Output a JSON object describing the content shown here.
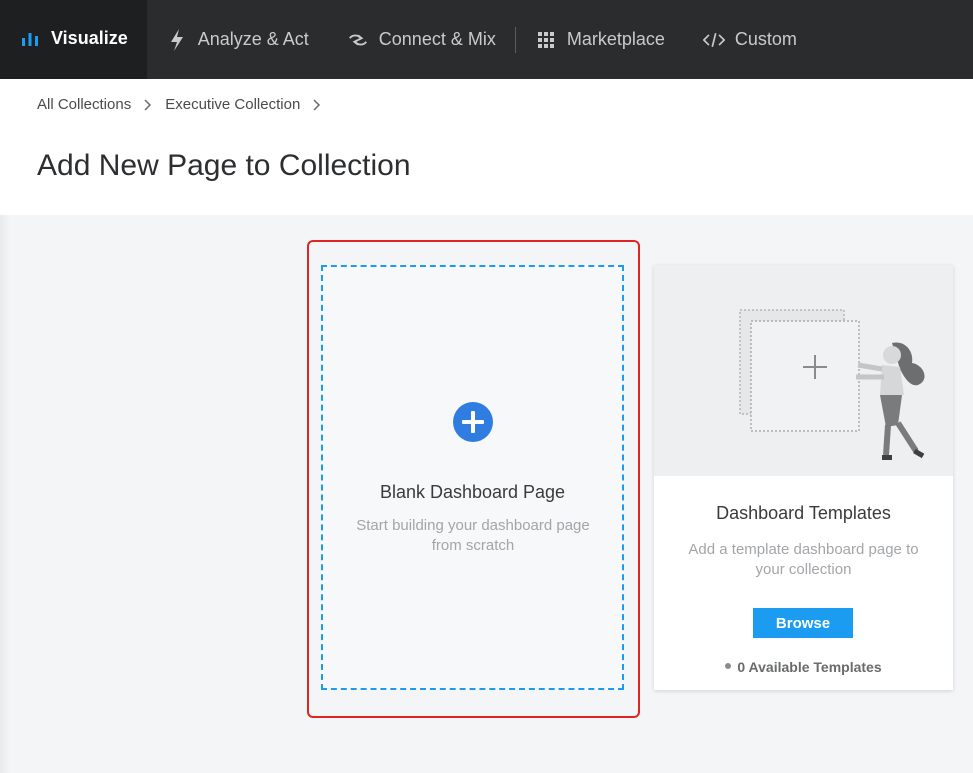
{
  "nav": {
    "items": [
      {
        "label": "Visualize",
        "icon": "bar-chart-icon",
        "active": true
      },
      {
        "label": "Analyze & Act",
        "icon": "lightning-icon",
        "active": false
      },
      {
        "label": "Connect & Mix",
        "icon": "connect-arrows-icon",
        "active": false
      },
      {
        "label": "Marketplace",
        "icon": "grid-icon",
        "active": false
      },
      {
        "label": "Custom",
        "icon": "code-icon",
        "active": false
      }
    ]
  },
  "breadcrumb": {
    "items": [
      "All Collections",
      "Executive Collection"
    ]
  },
  "page": {
    "title": "Add New Page to Collection"
  },
  "blank_card": {
    "title": "Blank Dashboard Page",
    "description": "Start building your dashboard page from scratch",
    "icon": "plus-circle-icon"
  },
  "templates_card": {
    "title": "Dashboard Templates",
    "description": "Add a template dashboard page to your collection",
    "button_label": "Browse",
    "count_text": "0 Available Templates"
  },
  "colors": {
    "accent": "#1c9cf0",
    "highlight": "#e02323",
    "nav_bg": "#2b2c2e"
  }
}
